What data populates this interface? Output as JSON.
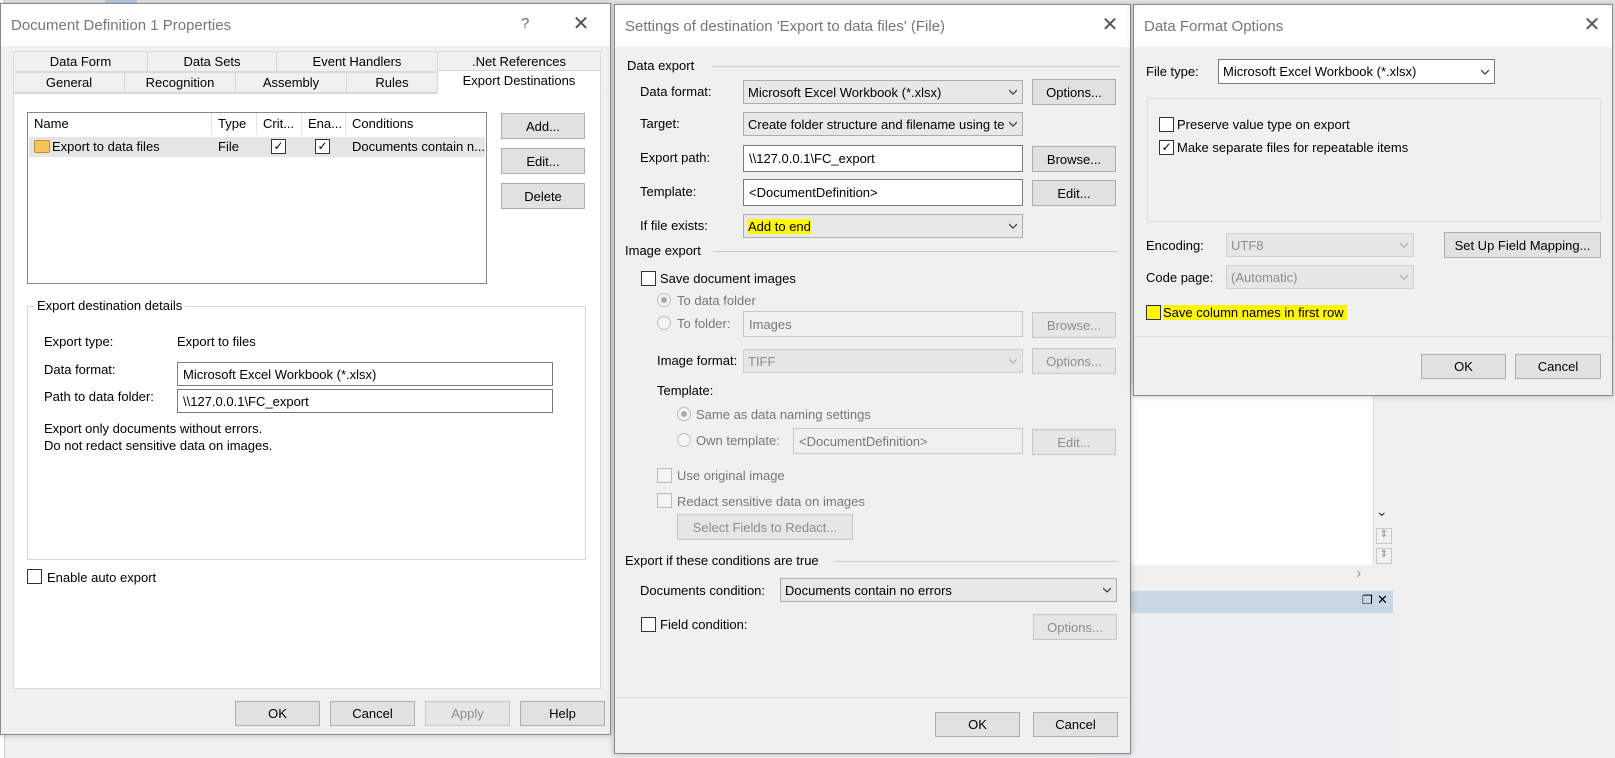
{
  "bg": {
    "nav_down_glyph": "⌄",
    "nav_right_glyph": "›",
    "restore_glyph": "❐",
    "close_glyph": "✕",
    "mini_scroll_glyph": "⇕"
  },
  "dlg1": {
    "title": "Document Definition 1 Properties",
    "help_label": "?",
    "tabs_row1": [
      "Data Form",
      "Data Sets",
      "Event Handlers",
      ".Net References"
    ],
    "tabs_row2": [
      "General",
      "Recognition",
      "Assembly",
      "Rules",
      "Export Destinations"
    ],
    "active_tab": "Export Destinations",
    "table": {
      "columns": [
        "Name",
        "Type",
        "Crit...",
        "Ena...",
        "Conditions"
      ],
      "rows": [
        {
          "name": "Export to data files",
          "type": "File",
          "critical": "✓",
          "enabled": "✓",
          "conditions": "Documents contain n..."
        }
      ]
    },
    "buttons": {
      "add": "Add...",
      "edit": "Edit...",
      "delete": "Delete"
    },
    "details": {
      "legend": "Export destination details",
      "export_type_label": "Export type:",
      "export_type_value": "Export to files",
      "data_format_label": "Data format:",
      "data_format_value": "Microsoft Excel Workbook (*.xlsx)",
      "path_label": "Path to data folder:",
      "path_value": "\\\\127.0.0.1\\FC_export",
      "note1": "Export only documents without errors.",
      "note2": "Do not redact sensitive data on images."
    },
    "auto_export_label": "Enable auto export",
    "footer": {
      "ok": "OK",
      "cancel": "Cancel",
      "apply": "Apply",
      "help": "Help"
    }
  },
  "dlg2": {
    "title": "Settings of destination 'Export to data files' (File)",
    "data_export": {
      "heading": "Data export",
      "format_label": "Data format:",
      "format_value": "Microsoft Excel Workbook (*.xlsx)",
      "options_button": "Options...",
      "target_label": "Target:",
      "target_value": "Create folder structure and filename using te",
      "path_label": "Export path:",
      "path_value": "\\\\127.0.0.1\\FC_export",
      "browse_button": "Browse...",
      "template_label": "Template:",
      "template_value": "<DocumentDefinition>",
      "edit_button": "Edit...",
      "if_exists_label": "If file exists:",
      "if_exists_value": "Add to end"
    },
    "image_export": {
      "heading": "Image export",
      "save_images_label": "Save document images",
      "to_data_folder": "To data folder",
      "to_folder": "To folder:",
      "folder_value": "Images",
      "browse_button": "Browse...",
      "format_label": "Image format:",
      "format_value": "TIFF",
      "options_button": "Options...",
      "template_label": "Template:",
      "same_as": "Same as data naming settings",
      "own_template": "Own template:",
      "own_template_value": "<DocumentDefinition>",
      "edit_button": "Edit...",
      "use_original": "Use original image",
      "redact": "Redact sensitive data on images",
      "select_fields_button": "Select Fields to Redact..."
    },
    "conditions": {
      "heading": "Export if these conditions are true",
      "doc_condition_label": "Documents condition:",
      "doc_condition_value": "Documents contain no errors",
      "field_condition_label": "Field condition:",
      "options_button": "Options..."
    },
    "footer": {
      "ok": "OK",
      "cancel": "Cancel"
    }
  },
  "dlg3": {
    "title": "Data Format Options",
    "file_type_label": "File type:",
    "file_type_value": "Microsoft Excel Workbook (*.xlsx)",
    "preserve_label": "Preserve value type on export",
    "separate_label": "Make separate files for repeatable items",
    "separate_check": "✓",
    "encoding_label": "Encoding:",
    "encoding_value": "UTF8",
    "mapping_button": "Set Up Field Mapping...",
    "codepage_label": "Code page:",
    "codepage_value": "(Automatic)",
    "save_columns_label": "Save column names in first row",
    "footer": {
      "ok": "OK",
      "cancel": "Cancel"
    }
  },
  "colors": {
    "highlight": "#fff600",
    "panel_blue": "#c9d6e3"
  }
}
